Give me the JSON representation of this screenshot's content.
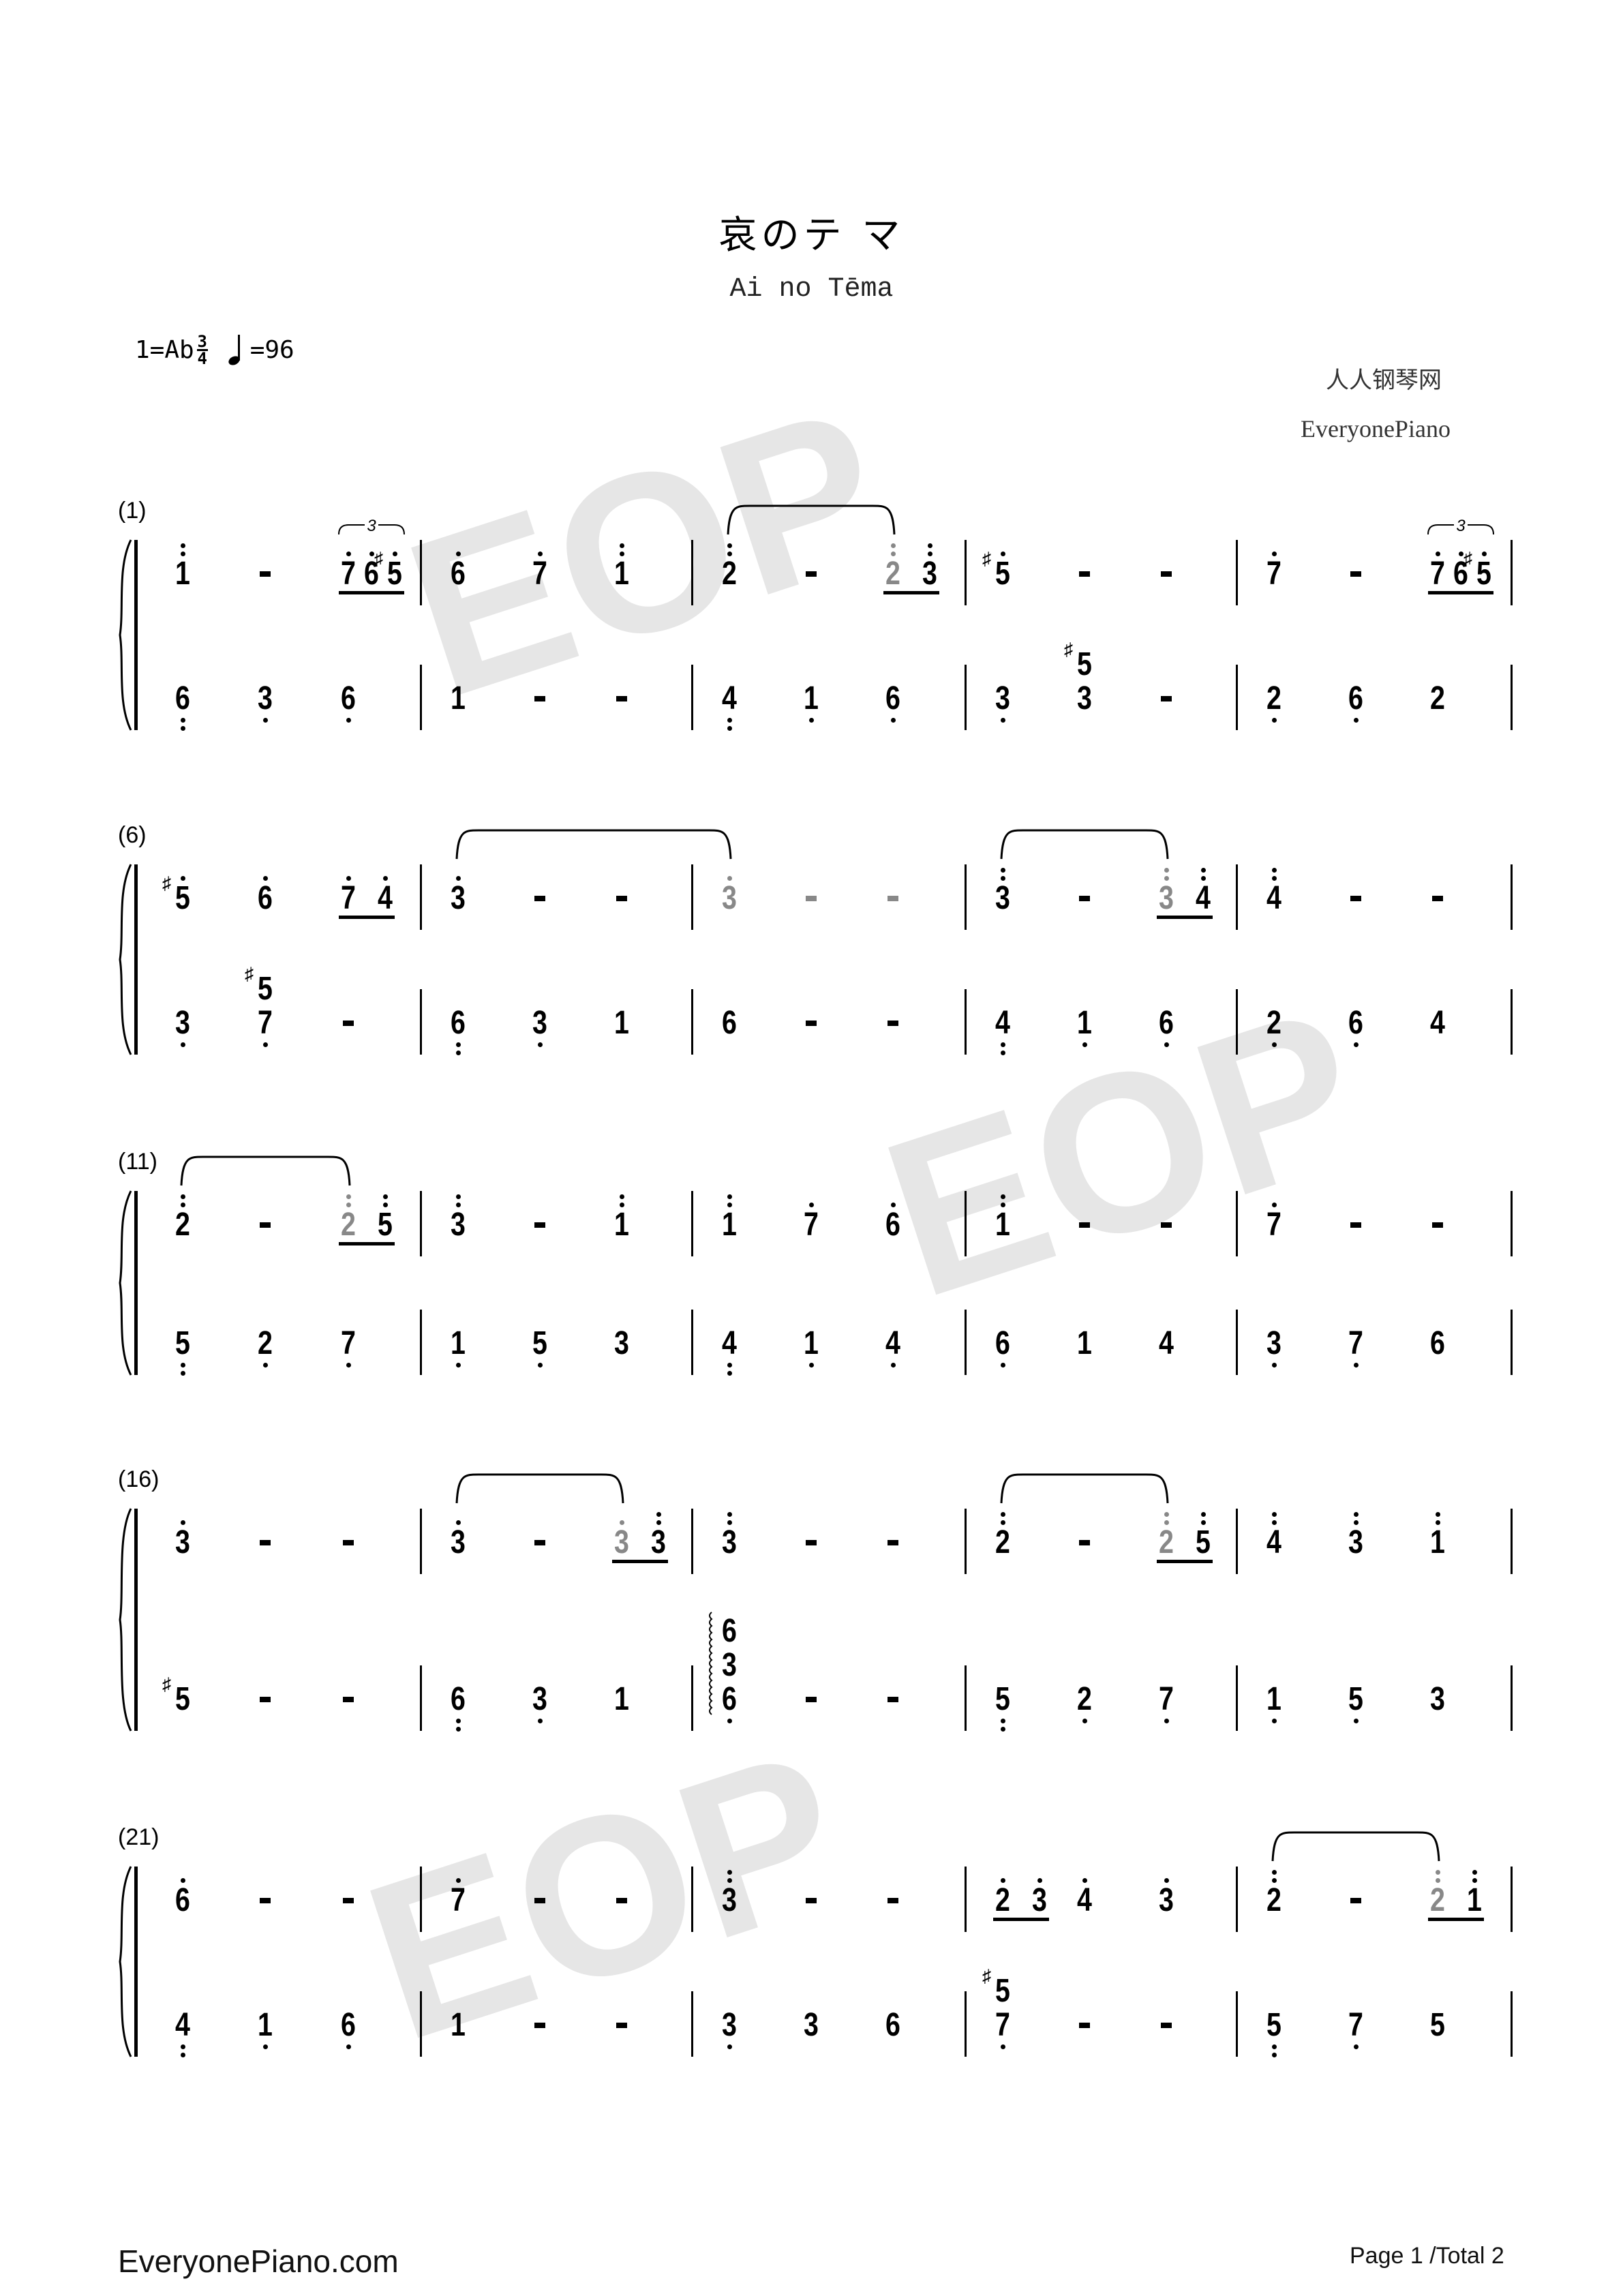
{
  "title": "哀のテ マ",
  "subtitle": "Ai no Tēma",
  "key": "1=Ab",
  "time_signature": {
    "numerator": "3",
    "denominator": "4"
  },
  "tempo": "=96",
  "tempo_icon": "quarter-note-icon",
  "publisher_cn": "人人钢琴网",
  "publisher_en": "EveryonePiano",
  "watermark": "EOP",
  "footer": {
    "site": "EveryonePiano.com",
    "page": "Page 1 /Total 2"
  },
  "colors": {
    "tied_note": "#888888",
    "watermark": "#e6e6e6",
    "ink": "#000000"
  },
  "notation_legend": "' = upper octave dot, , = lower octave dot, # = sharp, * = grey tied note, / = chord (bottom first), ~ = arpeggio, 3: = triplet",
  "systems": [
    {
      "label": "(1)",
      "measures": [
        {
          "top": [
            "1''",
            "-",
            "3:7' 6' #5'"
          ],
          "bottom": [
            "6,,",
            "3,",
            "6,"
          ]
        },
        {
          "top": [
            "6'",
            "7'",
            "1''"
          ],
          "bottom": [
            "1",
            "-",
            "-"
          ]
        },
        {
          "top": [
            "2''",
            "-",
            "2''* 3''"
          ],
          "bottom": [
            "4,,",
            "1,",
            "6,"
          ]
        },
        {
          "top": [
            "#5'",
            "-",
            "-"
          ],
          "bottom": [
            "3,",
            "3/#5",
            "-"
          ]
        },
        {
          "top": [
            "7'",
            "-",
            "3:7' 6' #5'"
          ],
          "bottom": [
            "2,",
            "6,",
            "2"
          ]
        }
      ],
      "slurs": [
        {
          "from": [
            2,
            0,
            0
          ],
          "to": [
            2,
            2,
            0
          ]
        }
      ]
    },
    {
      "label": "(6)",
      "measures": [
        {
          "top": [
            "#5'",
            "6'",
            "7' 4'"
          ],
          "bottom": [
            "3,",
            "7,/#5",
            "-"
          ]
        },
        {
          "top": [
            "3'",
            "-",
            "-"
          ],
          "bottom": [
            "6,,",
            "3,",
            "1"
          ]
        },
        {
          "top": [
            "3'*",
            "-*",
            "-*"
          ],
          "bottom": [
            "6",
            "-",
            "-"
          ]
        },
        {
          "top": [
            "3''",
            "-",
            "3''* 4''"
          ],
          "bottom": [
            "4,,",
            "1,",
            "6,"
          ]
        },
        {
          "top": [
            "4''",
            "-",
            "-"
          ],
          "bottom": [
            "2,",
            "6,",
            "4"
          ]
        }
      ],
      "slurs": [
        {
          "from": [
            1,
            0,
            0
          ],
          "to": [
            2,
            0,
            0
          ]
        },
        {
          "from": [
            3,
            0,
            0
          ],
          "to": [
            3,
            2,
            0
          ]
        }
      ]
    },
    {
      "label": "(11)",
      "measures": [
        {
          "top": [
            "2''",
            "-",
            "2''* 5''"
          ],
          "bottom": [
            "5,,",
            "2,",
            "7,"
          ]
        },
        {
          "top": [
            "3''",
            "-",
            "1''"
          ],
          "bottom": [
            "1,",
            "5,",
            "3"
          ]
        },
        {
          "top": [
            "1''",
            "7'",
            "6'"
          ],
          "bottom": [
            "4,,",
            "1,",
            "4,"
          ]
        },
        {
          "top": [
            "1''",
            "-",
            "-"
          ],
          "bottom": [
            "6,",
            "1",
            "4"
          ]
        },
        {
          "top": [
            "7'",
            "-",
            "-"
          ],
          "bottom": [
            "3,",
            "7,",
            "6"
          ]
        }
      ],
      "slurs": [
        {
          "from": [
            0,
            0,
            0
          ],
          "to": [
            0,
            2,
            0
          ]
        }
      ]
    },
    {
      "label": "(16)",
      "measures": [
        {
          "top": [
            "3'",
            "-",
            "-"
          ],
          "bottom": [
            "#5",
            "-",
            "-"
          ]
        },
        {
          "top": [
            "3'",
            "-",
            "3'* 3''"
          ],
          "bottom": [
            "6,,",
            "3,",
            "1"
          ]
        },
        {
          "top": [
            "3''",
            "-",
            "-"
          ],
          "bottom": [
            "~6,/3/6",
            "-",
            "-"
          ]
        },
        {
          "top": [
            "2''",
            "-",
            "2''* 5''"
          ],
          "bottom": [
            "5,,",
            "2,",
            "7,"
          ]
        },
        {
          "top": [
            "4''",
            "3''",
            "1''"
          ],
          "bottom": [
            "1,",
            "5,",
            "3"
          ]
        }
      ],
      "slurs": [
        {
          "from": [
            1,
            0,
            0
          ],
          "to": [
            1,
            2,
            0
          ]
        },
        {
          "from": [
            3,
            0,
            0
          ],
          "to": [
            3,
            2,
            0
          ]
        }
      ]
    },
    {
      "label": "(21)",
      "measures": [
        {
          "top": [
            "6'",
            "-",
            "-"
          ],
          "bottom": [
            "4,,",
            "1,",
            "6,"
          ]
        },
        {
          "top": [
            "7'",
            "-",
            "-"
          ],
          "bottom": [
            "1",
            "-",
            "-"
          ]
        },
        {
          "top": [
            "3''",
            "-",
            "-"
          ],
          "bottom": [
            "3,",
            "3",
            "6"
          ]
        },
        {
          "top": [
            "2' 3'",
            "4'",
            "3'"
          ],
          "bottom": [
            "7,/#5",
            "-",
            "-"
          ]
        },
        {
          "top": [
            "2''",
            "-",
            "2''* 1''"
          ],
          "bottom": [
            "5,,",
            "7,",
            "5"
          ]
        }
      ],
      "slurs": [
        {
          "from": [
            4,
            0,
            0
          ],
          "to": [
            4,
            2,
            0
          ]
        }
      ]
    }
  ]
}
